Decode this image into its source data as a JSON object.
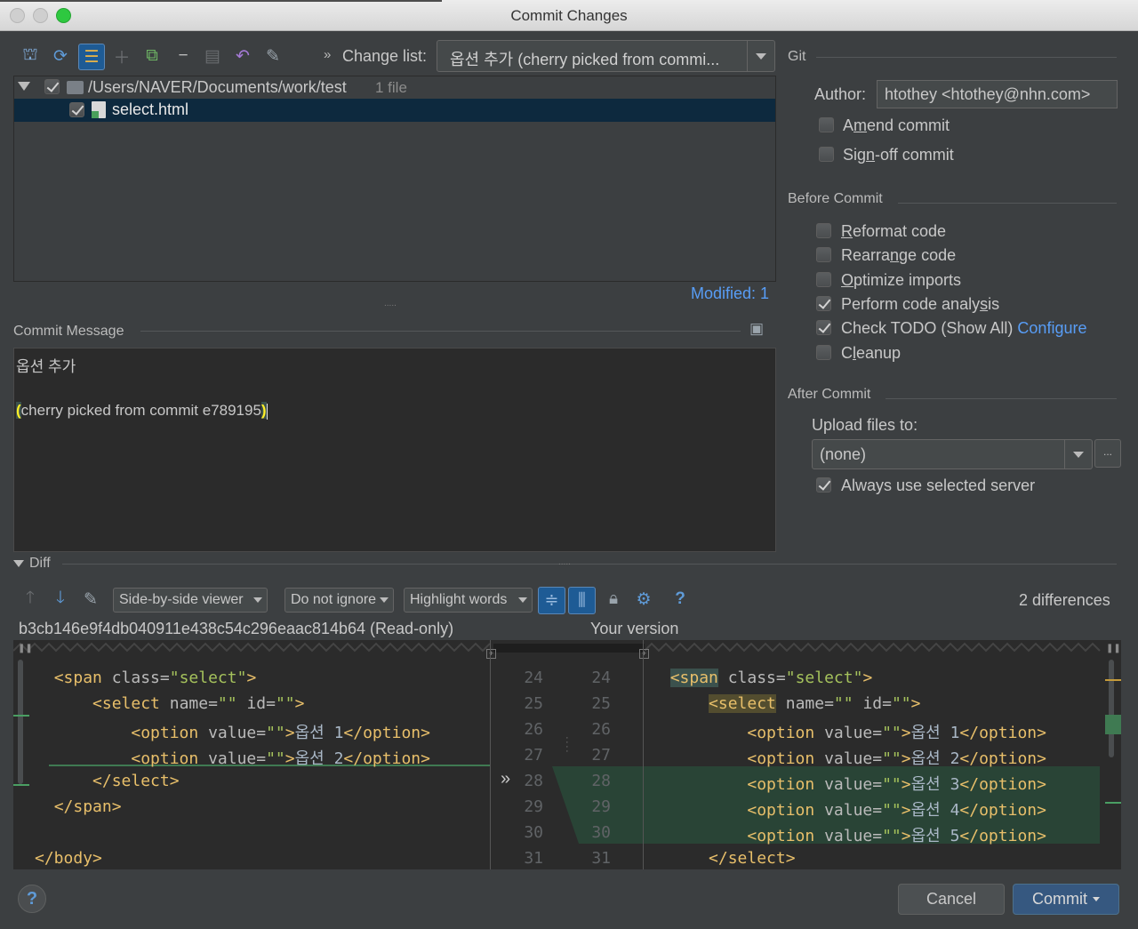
{
  "window": {
    "title": "Commit Changes"
  },
  "toolbar": {
    "change_list_label": "Change list:",
    "change_list_value": "옵션 추가  (cherry picked from commi..."
  },
  "changes": {
    "root_path": "/Users/NAVER/Documents/work/test",
    "root_count": "1 file",
    "file_name": "select.html",
    "modified": "Modified: 1"
  },
  "commit_message": {
    "title": "Commit Message",
    "line1": "옵션 추가",
    "line2_open": "(",
    "line2_body": "cherry picked from commit e789195",
    "line2_close": ")"
  },
  "git": {
    "title": "Git",
    "author_label": "Author:",
    "author_value": "htothey <htothey@nhn.com>",
    "amend_pre": "A",
    "amend_u": "m",
    "amend_post": "end commit",
    "signoff_pre": "Sig",
    "signoff_u": "n",
    "signoff_post": "-off commit"
  },
  "before_commit": {
    "title": "Before Commit",
    "reformat_u": "R",
    "reformat_post": "eformat code",
    "rearrange_pre": "Rearra",
    "rearrange_u": "n",
    "rearrange_post": "ge code",
    "optimize_u": "O",
    "optimize_post": "ptimize imports",
    "analysis_pre": "Perform code analy",
    "analysis_u": "s",
    "analysis_post": "is",
    "todo": "Check TODO (Show All)",
    "todo_link": "Configure",
    "cleanup_pre": "C",
    "cleanup_u": "l",
    "cleanup_post": "eanup"
  },
  "after_commit": {
    "title": "After Commit",
    "upload_label": "Upload files to:",
    "upload_value": "(none)",
    "ellipsis": "...",
    "always_use": "Always use selected server"
  },
  "diff": {
    "title": "Diff",
    "viewer": "Side-by-side viewer",
    "ignore": "Do not ignore",
    "highlight": "Highlight words",
    "help": "?",
    "differences": "2 differences",
    "left_header": "b3cb146e9f4db040911e438c54c296eaac814b64 (Read-only)",
    "right_header": "Your version",
    "left_lines": [
      24,
      25,
      26,
      27,
      28,
      29,
      30,
      31
    ],
    "right_lines": [
      24,
      25,
      26,
      27,
      28,
      29,
      30,
      31
    ],
    "gutter_mark": "»",
    "left_code": [
      {
        "indent": "  ",
        "open": "<span",
        "attr": " class=",
        "val": "\"select\"",
        "close": ">",
        "text": "",
        "end": ""
      },
      {
        "indent": "      ",
        "open": "<select",
        "attr": " name=",
        "val": "\"\"",
        "attr2": " id=",
        "val2": "\"\"",
        "close": ">",
        "text": "",
        "end": ""
      },
      {
        "indent": "          ",
        "open": "<option",
        "attr": " value=",
        "val": "\"\"",
        "close": ">",
        "text": "옵션 1",
        "end": "</option>"
      },
      {
        "indent": "          ",
        "open": "<option",
        "attr": " value=",
        "val": "\"\"",
        "close": ">",
        "text": "옵션 2",
        "end": "</option>"
      },
      {
        "indent": "      ",
        "open": "</select>",
        "attr": "",
        "val": "",
        "close": "",
        "text": "",
        "end": ""
      },
      {
        "indent": "  ",
        "open": "</span>",
        "attr": "",
        "val": "",
        "close": "",
        "text": "",
        "end": ""
      },
      {
        "indent": "",
        "open": "",
        "attr": "",
        "val": "",
        "close": "",
        "text": "",
        "end": ""
      },
      {
        "indent": "",
        "open": "</body>",
        "attr": "",
        "val": "",
        "close": "",
        "text": "",
        "end": ""
      }
    ],
    "right_code": [
      {
        "indent": "  ",
        "open": "<span",
        "attr": " class=",
        "val": "\"select\"",
        "close": ">",
        "text": "",
        "end": ""
      },
      {
        "indent": "      ",
        "open": "<select",
        "attr": " name=",
        "val": "\"\"",
        "attr2": " id=",
        "val2": "\"\"",
        "close": ">",
        "text": "",
        "end": ""
      },
      {
        "indent": "          ",
        "open": "<option",
        "attr": " value=",
        "val": "\"\"",
        "close": ">",
        "text": "옵션 1",
        "end": "</option>"
      },
      {
        "indent": "          ",
        "open": "<option",
        "attr": " value=",
        "val": "\"\"",
        "close": ">",
        "text": "옵션 2",
        "end": "</option>"
      },
      {
        "indent": "          ",
        "open": "<option",
        "attr": " value=",
        "val": "\"\"",
        "close": ">",
        "text": "옵션 3",
        "end": "</option>"
      },
      {
        "indent": "          ",
        "open": "<option",
        "attr": " value=",
        "val": "\"\"",
        "close": ">",
        "text": "옵션 4",
        "end": "</option>"
      },
      {
        "indent": "          ",
        "open": "<option",
        "attr": " value=",
        "val": "\"\"",
        "close": ">",
        "text": "옵션 5",
        "end": "</option>"
      },
      {
        "indent": "      ",
        "open": "</select>",
        "attr": "",
        "val": "",
        "close": "",
        "text": "",
        "end": ""
      }
    ]
  },
  "buttons": {
    "help": "?",
    "cancel": "Cancel",
    "commit": "Commit"
  },
  "colors": {
    "bg": "#3c3f41",
    "editor": "#2b2b2b",
    "accent": "#589df6",
    "selection": "#0d293e",
    "added": "#294436",
    "primary_button": "#365880"
  }
}
